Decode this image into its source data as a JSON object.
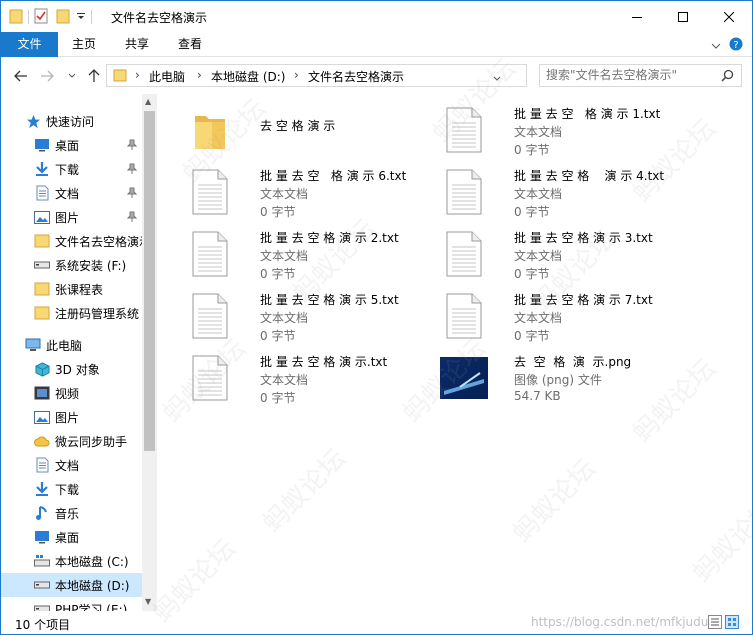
{
  "window": {
    "title": "文件名去空格演示"
  },
  "ribbon": {
    "tabs": [
      "文件",
      "主页",
      "共享",
      "查看"
    ]
  },
  "address": {
    "segments": [
      "此电脑",
      "本地磁盘 (D:)",
      "文件名去空格演示"
    ],
    "search_placeholder": "搜索\"文件名去空格演示\""
  },
  "nav": {
    "quick_access": "快速访问",
    "quick_items": [
      {
        "label": "桌面",
        "icon": "desktop-icon"
      },
      {
        "label": "下载",
        "icon": "download-icon"
      },
      {
        "label": "文档",
        "icon": "document-icon"
      },
      {
        "label": "图片",
        "icon": "picture-icon"
      },
      {
        "label": "文件名去空格演示",
        "icon": "folder-icon"
      },
      {
        "label": "系统安装 (F:)",
        "icon": "drive-icon"
      },
      {
        "label": "张课程表",
        "icon": "folder-icon"
      },
      {
        "label": "注册码管理系统",
        "icon": "folder-icon"
      }
    ],
    "this_pc": "此电脑",
    "pc_items": [
      {
        "label": "3D 对象",
        "icon": "3d-objects-icon"
      },
      {
        "label": "视频",
        "icon": "video-icon"
      },
      {
        "label": "图片",
        "icon": "picture-icon"
      },
      {
        "label": "微云同步助手",
        "icon": "cloud-icon"
      },
      {
        "label": "文档",
        "icon": "document-icon"
      },
      {
        "label": "下载",
        "icon": "download-icon"
      },
      {
        "label": "音乐",
        "icon": "music-icon"
      },
      {
        "label": "桌面",
        "icon": "desktop-icon"
      },
      {
        "label": "本地磁盘 (C:)",
        "icon": "system-drive-icon"
      },
      {
        "label": "本地磁盘 (D:)",
        "icon": "drive-icon",
        "selected": true
      },
      {
        "label": "PHP学习 (E:)",
        "icon": "drive-icon"
      }
    ]
  },
  "files": [
    {
      "name": "去 空 格 演 示",
      "kind": "folder"
    },
    {
      "name": "批 量 去 空   格 演 示 1.txt",
      "type": "文本文档",
      "size": "0 字节",
      "kind": "txt"
    },
    {
      "name": "批 量 去 空   格 演 示 6.txt",
      "type": "文本文档",
      "size": "0 字节",
      "kind": "txt"
    },
    {
      "name": "批 量 去 空 格    演 示 4.txt",
      "type": "文本文档",
      "size": "0 字节",
      "kind": "txt"
    },
    {
      "name": "批 量 去 空 格 演 示 2.txt",
      "type": "文本文档",
      "size": "0 字节",
      "kind": "txt"
    },
    {
      "name": "批 量 去 空 格 演 示 3.txt",
      "type": "文本文档",
      "size": "0 字节",
      "kind": "txt"
    },
    {
      "name": "批 量 去 空 格 演 示 5.txt",
      "type": "文本文档",
      "size": "0 字节",
      "kind": "txt"
    },
    {
      "name": "批 量 去 空 格 演 示 7.txt",
      "type": "文本文档",
      "size": "0 字节",
      "kind": "txt"
    },
    {
      "name": "批 量 去 空 格 演 示.txt",
      "type": "文本文档",
      "size": "0 字节",
      "kind": "txt"
    },
    {
      "name": "去  空  格  演  示.png",
      "type": "图像 (png) 文件",
      "size": "54.7 KB",
      "kind": "png"
    }
  ],
  "status": {
    "count": "10 个项目",
    "watermark_url": "https://blog.csdn.net/mfkjudu"
  },
  "watermark_text": "蚂蚁论坛",
  "colors": {
    "accent": "#1979ca",
    "selected": "#cce8ff",
    "folder": "#f8d775"
  }
}
